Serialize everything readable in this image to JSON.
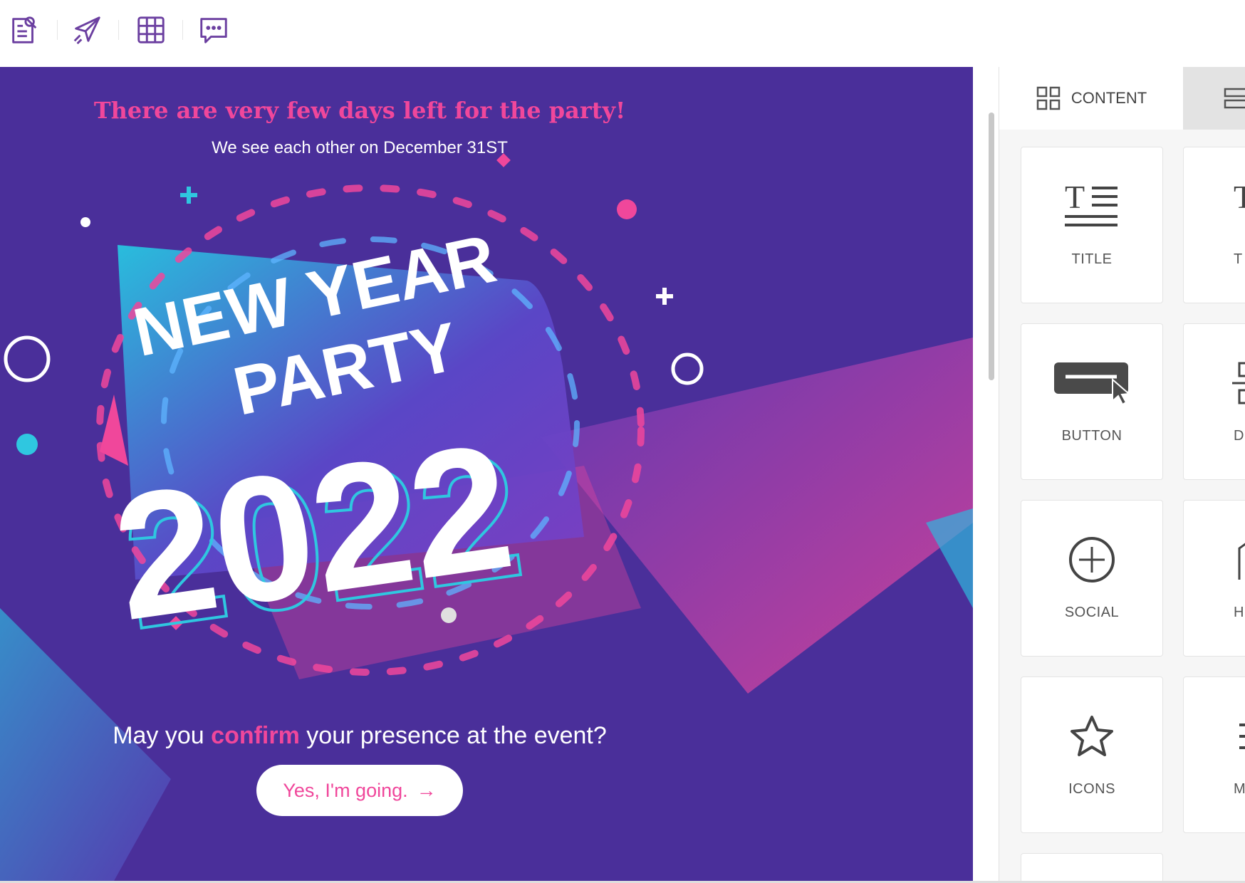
{
  "toolbar": {
    "tools": [
      {
        "icon": "document-search-icon"
      },
      {
        "icon": "paper-plane-icon"
      },
      {
        "icon": "grid-table-icon"
      },
      {
        "icon": "chat-bubble-icon"
      }
    ],
    "accent": "#6b3fa0"
  },
  "email": {
    "headline": "There are very few days left for the party!",
    "subline": "We see each other on December 31ST",
    "hero_line1": "NEW YEAR",
    "hero_line2": "PARTY",
    "hero_year": "2022",
    "question_before": "May you ",
    "question_accent": "confirm",
    "question_after": " your presence at the event?",
    "cta_label": "Yes, I'm going.",
    "cta_arrow": "→",
    "colors": {
      "background": "#4a2f9a",
      "accent": "#f0479b",
      "cyan": "#2fc7e0"
    }
  },
  "panel": {
    "tabs": [
      {
        "label": "CONTENT",
        "icon": "grid-blocks-icon",
        "active": true
      },
      {
        "label": "",
        "icon": "rows-icon",
        "active": false
      }
    ],
    "blocks": [
      {
        "label": "TITLE",
        "icon": "title-text-icon"
      },
      {
        "label": "T",
        "icon": "text-icon"
      },
      {
        "label": "BUTTON",
        "icon": "button-cursor-icon"
      },
      {
        "label": "DI",
        "icon": "divider-icon"
      },
      {
        "label": "SOCIAL",
        "icon": "plus-circle-icon"
      },
      {
        "label": "H",
        "icon": "html-icon"
      },
      {
        "label": "ICONS",
        "icon": "star-icon"
      },
      {
        "label": "M",
        "icon": "menu-icon"
      }
    ]
  }
}
